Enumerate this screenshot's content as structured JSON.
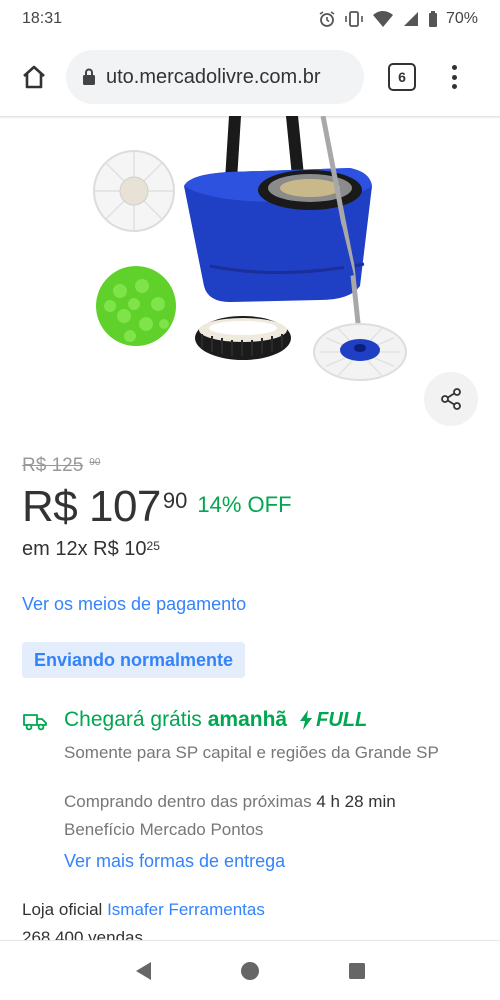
{
  "status_bar": {
    "time": "18:31",
    "battery": "70%"
  },
  "browser": {
    "url": "uto.mercadolivre.com.br",
    "tab_count": "6"
  },
  "product": {
    "old_price_main": "R$ 125",
    "old_price_cents": "90",
    "price_main": "R$ 107",
    "price_cents": "90",
    "discount": "14% OFF",
    "installments_main": "em 12x R$ 10",
    "installments_cents": "25",
    "payment_link": "Ver os meios de pagamento",
    "shipping_tag": "Enviando normalmente"
  },
  "delivery": {
    "title_prefix": "Chegará grátis",
    "title_day": "amanhã",
    "full_label": "FULL",
    "note": "Somente para SP capital e regiões da Grande SP",
    "time_prefix": "Comprando dentro das próximas",
    "time_value": "4 h 28 min",
    "benefit": "Benefício Mercado Pontos",
    "more_link": "Ver mais formas de entrega"
  },
  "seller": {
    "prefix": "Loja oficial",
    "name": "Ismafer Ferramentas",
    "sales": "268.400 vendas"
  },
  "colors": {
    "accent_blue": "#3483fa",
    "success_green": "#00a650",
    "text_dark": "#333333",
    "text_muted": "#777777"
  }
}
